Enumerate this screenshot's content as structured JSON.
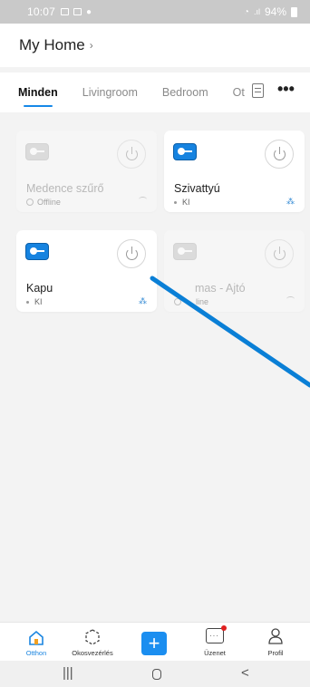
{
  "status_bar": {
    "time": "10:07",
    "battery": "94%"
  },
  "header": {
    "title": "My Home",
    "chevron": "›"
  },
  "tabs": [
    {
      "label": "Minden",
      "active": true
    },
    {
      "label": "Livingroom",
      "active": false
    },
    {
      "label": "Bedroom",
      "active": false
    },
    {
      "label": "Ot",
      "active": false
    }
  ],
  "tab_more": "•••",
  "devices": [
    {
      "name": "Medence szűrő",
      "status": "Offline",
      "online": false
    },
    {
      "name": "Szivattyú",
      "status": "KI",
      "online": true
    },
    {
      "name": "Kapu",
      "status": "KI",
      "online": true
    },
    {
      "name": "mas - Ajtó",
      "status": "line",
      "online": false
    }
  ],
  "bottom_nav": [
    {
      "label": "Otthon",
      "icon": "home-icon",
      "active": true
    },
    {
      "label": "Okosvezérlés",
      "icon": "smart-scene-icon",
      "active": false
    },
    {
      "label": "+",
      "icon": "add-icon",
      "active": false
    },
    {
      "label": "Üzenet",
      "icon": "message-icon",
      "active": false
    },
    {
      "label": "Profil",
      "icon": "profile-icon",
      "active": false
    }
  ],
  "system_nav": {
    "recent": "|||",
    "back": "<"
  },
  "colors": {
    "accent": "#1b8ef0",
    "annotation_line": "#0a7fd6",
    "badge": "#e02020"
  }
}
